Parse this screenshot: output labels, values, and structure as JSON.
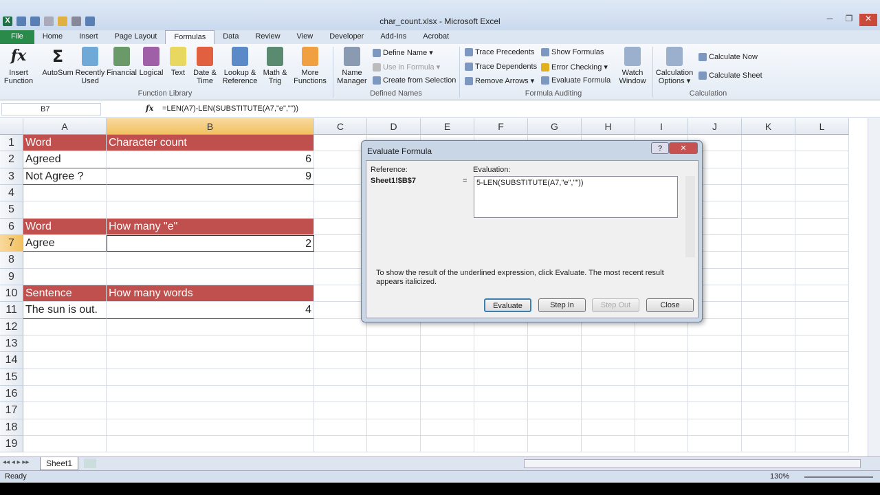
{
  "window": {
    "title": "char_count.xlsx - Microsoft Excel",
    "app_icon": "X"
  },
  "tabs": [
    "File",
    "Home",
    "Insert",
    "Page Layout",
    "Formulas",
    "Data",
    "Review",
    "View",
    "Developer",
    "Add-Ins",
    "Acrobat"
  ],
  "active_tab": "Formulas",
  "ribbon": {
    "function_library": {
      "label": "Function Library",
      "buttons": [
        "Insert Function",
        "AutoSum",
        "Recently Used",
        "Financial",
        "Logical",
        "Text",
        "Date & Time",
        "Lookup & Reference",
        "Math & Trig",
        "More Functions"
      ]
    },
    "defined_names": {
      "label": "Defined Names",
      "name_manager": "Name Manager",
      "define_name": "Define Name",
      "use_in_formula": "Use in Formula",
      "create_from_selection": "Create from Selection"
    },
    "formula_auditing": {
      "label": "Formula Auditing",
      "trace_precedents": "Trace Precedents",
      "trace_dependents": "Trace Dependents",
      "remove_arrows": "Remove Arrows",
      "show_formulas": "Show Formulas",
      "error_checking": "Error Checking",
      "evaluate_formula": "Evaluate Formula",
      "watch_window": "Watch Window"
    },
    "calculation": {
      "label": "Calculation",
      "options": "Calculation Options",
      "calc_now": "Calculate Now",
      "calc_sheet": "Calculate Sheet"
    }
  },
  "formula_bar": {
    "name_box": "B7",
    "fx": "fx",
    "formula": "=LEN(A7)-LEN(SUBSTITUTE(A7,\"e\",\"\"))"
  },
  "columns": [
    "A",
    "B",
    "C",
    "D",
    "E",
    "F",
    "G",
    "H",
    "I",
    "J",
    "K",
    "L"
  ],
  "rows": [
    "1",
    "2",
    "3",
    "4",
    "5",
    "6",
    "7",
    "8",
    "9",
    "10",
    "11",
    "12",
    "13",
    "14",
    "15",
    "16",
    "17",
    "18",
    "19"
  ],
  "cells": {
    "A1": "Word",
    "B1": "Character count",
    "A2": "Agreed",
    "B2": "6",
    "A3": "Not Agree ?",
    "B3": "9",
    "A6": "Word",
    "B6": "How many \"e\"",
    "A7": "Agree",
    "B7": "2",
    "A10": "Sentence",
    "B10": "How many words",
    "A11": "The sun is out.",
    "B11": "4"
  },
  "header_color": "#c0504d",
  "sheet_tab": "Sheet1",
  "status": {
    "mode": "Ready",
    "zoom": "130%"
  },
  "dialog": {
    "title": "Evaluate Formula",
    "help": "?",
    "close": "✕",
    "reference_label": "Reference:",
    "reference": "Sheet1!$B$7",
    "equals": "=",
    "evaluation_label": "Evaluation:",
    "evaluation": "5-LEN(SUBSTITUTE(A7,\"e\",\"\"))",
    "hint": "To show the result of the underlined expression, click Evaluate.  The most recent result appears italicized.",
    "buttons": [
      "Evaluate",
      "Step In",
      "Step Out",
      "Close"
    ]
  }
}
